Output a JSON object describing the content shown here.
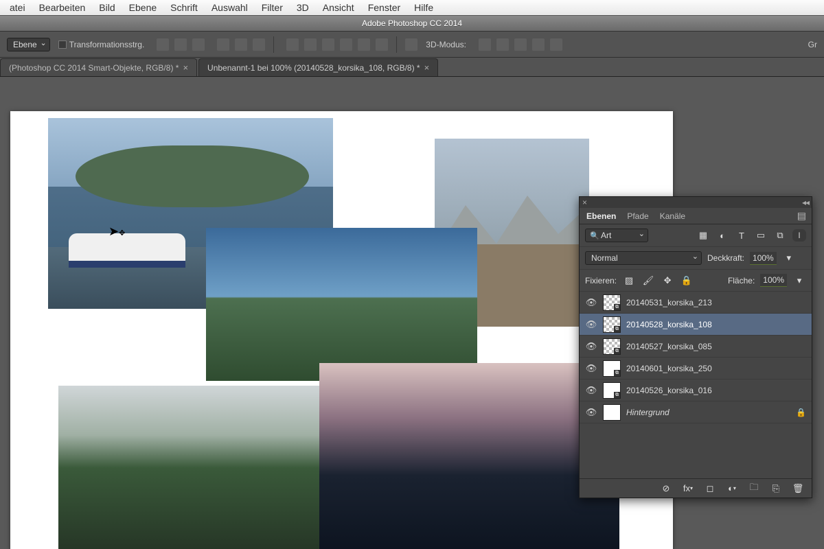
{
  "mac_menu": [
    "atei",
    "Bearbeiten",
    "Bild",
    "Ebene",
    "Schrift",
    "Auswahl",
    "Filter",
    "3D",
    "Ansicht",
    "Fenster",
    "Hilfe"
  ],
  "titlebar": "Adobe Photoshop CC 2014",
  "options": {
    "mode_select": "Ebene",
    "transform_controls": "Transformationsstrg.",
    "mode_3d": "3D-Modus:",
    "right_label": "Gr"
  },
  "tabs": [
    {
      "label": "(Photoshop CC 2014  Smart-Objekte, RGB/8) *",
      "close": "×",
      "active": false
    },
    {
      "label": "Unbenannt-1 bei 100% (20140528_korsika_108, RGB/8) *",
      "close": "×",
      "active": true
    }
  ],
  "panel": {
    "tabs": {
      "layers": "Ebenen",
      "paths": "Pfade",
      "channels": "Kanäle"
    },
    "filter_kind": "Art",
    "blend_mode": "Normal",
    "opacity_label": "Deckkraft:",
    "opacity_value": "100%",
    "lock_label": "Fixieren:",
    "fill_label": "Fläche:",
    "fill_value": "100%",
    "layers": [
      {
        "name": "20140531_korsika_213",
        "visible": true,
        "checker": true,
        "selected": false
      },
      {
        "name": "20140528_korsika_108",
        "visible": true,
        "checker": true,
        "selected": true
      },
      {
        "name": "20140527_korsika_085",
        "visible": true,
        "checker": true,
        "selected": false
      },
      {
        "name": "20140601_korsika_250",
        "visible": true,
        "checker": false,
        "selected": false
      },
      {
        "name": "20140526_korsika_016",
        "visible": true,
        "checker": false,
        "selected": false
      },
      {
        "name": "Hintergrund",
        "visible": true,
        "checker": false,
        "selected": false,
        "locked": true,
        "italic": true,
        "white": true
      }
    ]
  }
}
